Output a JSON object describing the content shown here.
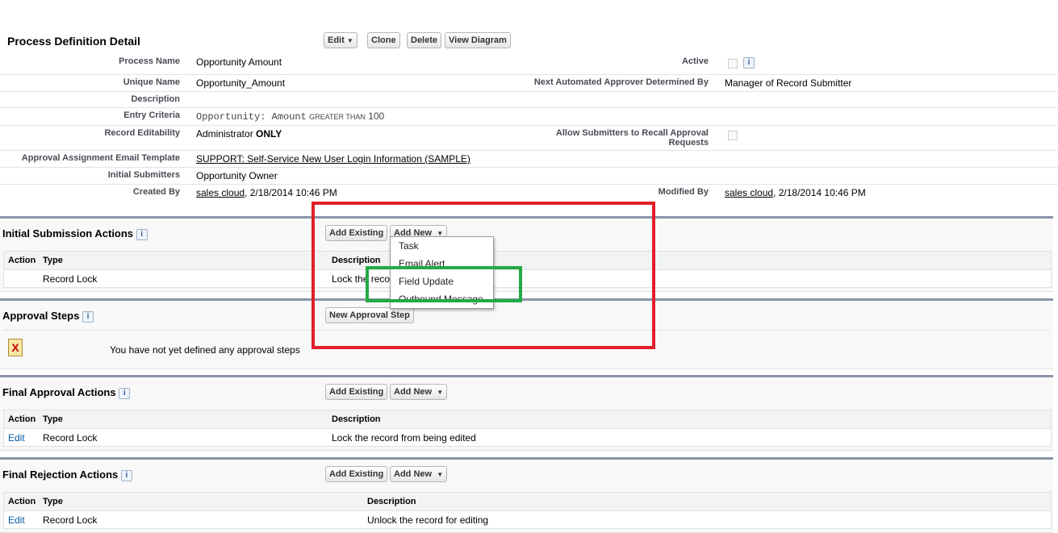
{
  "header": {
    "title": "Process Definition Detail",
    "edit": "Edit",
    "clone": "Clone",
    "delete": "Delete",
    "view_diagram": "View Diagram"
  },
  "fields": {
    "process_name_label": "Process Name",
    "process_name": "Opportunity Amount",
    "active_label": "Active",
    "unique_name_label": "Unique Name",
    "unique_name": "Opportunity_Amount",
    "next_approver_label": "Next Automated Approver Determined By",
    "next_approver": "Manager of Record Submitter",
    "description_label": "Description",
    "entry_criteria_label": "Entry Criteria",
    "entry_field": "Opportunity: Amount",
    "entry_op": "GREATER THAN",
    "entry_value": "100",
    "record_editability_label": "Record Editability",
    "record_editability": "Administrator",
    "record_editability_bold": "ONLY",
    "allow_recall_label": "Allow Submitters to Recall Approval Requests",
    "email_template_label": "Approval Assignment Email Template",
    "email_template": "SUPPORT: Self-Service New User Login Information (SAMPLE)",
    "initial_submitters_label": "Initial Submitters",
    "initial_submitters": "Opportunity Owner",
    "created_by_label": "Created By",
    "created_by_user": "sales cloud",
    "created_by_date": ", 2/18/2014 10:46 PM",
    "modified_by_label": "Modified By",
    "modified_by_user": "sales cloud",
    "modified_by_date": ", 2/18/2014 10:46 PM"
  },
  "info_icon": "i",
  "initial_submission": {
    "title": "Initial Submission Actions",
    "add_existing": "Add Existing",
    "add_new": "Add New",
    "columns": [
      "Action",
      "Type",
      "Description"
    ],
    "rows": [
      {
        "action": "",
        "type": "Record Lock",
        "description": "Lock the reco"
      }
    ]
  },
  "add_new_menu": [
    "Task",
    "Email Alert",
    "Field Update",
    "Outbound Message"
  ],
  "approval_steps": {
    "title": "Approval Steps",
    "new_step": "New Approval Step",
    "empty": "You have not yet defined any approval steps"
  },
  "final_approval": {
    "title": "Final Approval Actions",
    "add_existing": "Add Existing",
    "add_new": "Add New",
    "columns": [
      "Action",
      "Type",
      "Description"
    ],
    "rows": [
      {
        "action": "Edit",
        "type": "Record Lock",
        "description": "Lock the record from being edited"
      }
    ]
  },
  "final_rejection": {
    "title": "Final Rejection Actions",
    "add_existing": "Add Existing",
    "add_new": "Add New",
    "columns": [
      "Action",
      "Type",
      "Description"
    ],
    "rows": [
      {
        "action": "Edit",
        "type": "Record Lock",
        "description": "Unlock the record for editing"
      }
    ]
  },
  "annotations": {
    "red_box_color": "#e0202a",
    "green_box_color": "#22aa44"
  }
}
